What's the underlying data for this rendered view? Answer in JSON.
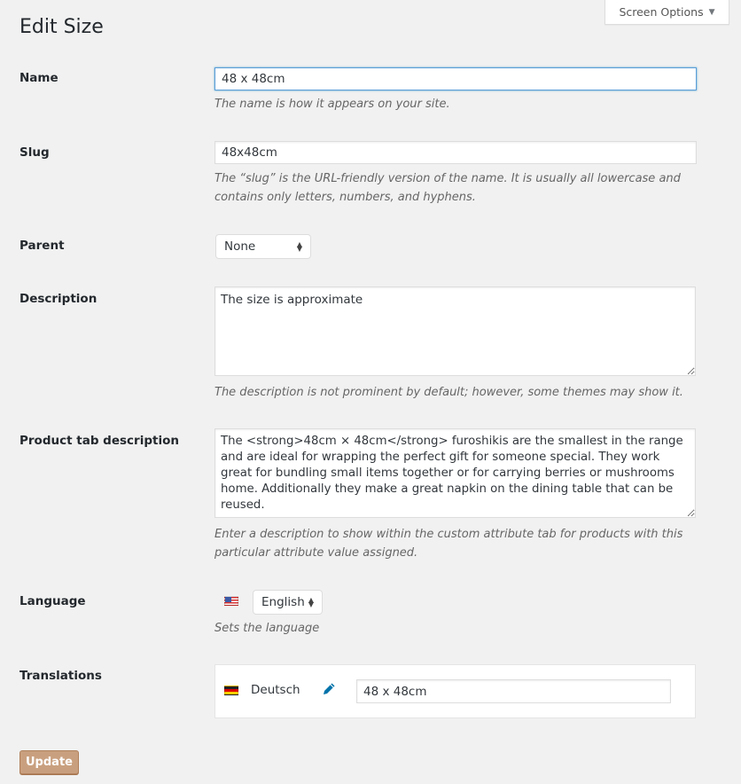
{
  "screen_options": {
    "label": "Screen Options",
    "arrow": "▼"
  },
  "page_title": "Edit Size",
  "fields": {
    "name": {
      "label": "Name",
      "value": "48 x 48cm",
      "hint": "The name is how it appears on your site."
    },
    "slug": {
      "label": "Slug",
      "value": "48x48cm",
      "hint": "The “slug” is the URL-friendly version of the name. It is usually all lowercase and contains only letters, numbers, and hyphens."
    },
    "parent": {
      "label": "Parent",
      "selected": "None"
    },
    "description": {
      "label": "Description",
      "value": "The size is approximate",
      "hint": "The description is not prominent by default; however, some themes may show it."
    },
    "product_tab_description": {
      "label": "Product tab description",
      "value": "The <strong>48cm × 48cm</strong> furoshikis are the smallest in the range and are ideal for wrapping the perfect gift for someone special. They work great for bundling small items together or for carrying berries or mushrooms home. Additionally they make a great napkin on the dining table that can be reused.",
      "hint": "Enter a description to show within the custom attribute tab for products with this particular attribute value assigned."
    },
    "language": {
      "label": "Language",
      "flag": "us-flag-icon",
      "selected": "English",
      "hint": "Sets the language"
    },
    "translations": {
      "label": "Translations",
      "items": [
        {
          "language": "Deutsch",
          "flag": "de-flag-icon",
          "value": "48 x 48cm"
        }
      ]
    }
  },
  "update_button": "Update"
}
